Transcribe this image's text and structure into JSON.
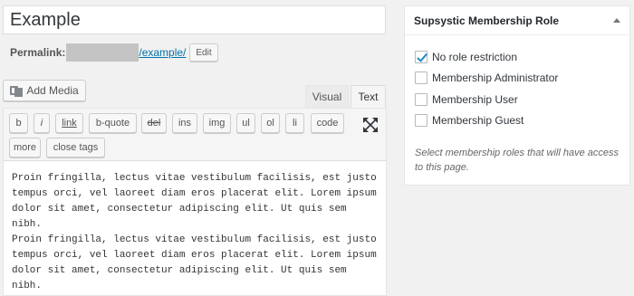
{
  "post": {
    "title": "Example",
    "permalink_label": "Permalink:",
    "permalink_slug": "/example/",
    "edit_label": "Edit"
  },
  "editor": {
    "add_media_label": "Add Media",
    "tabs": {
      "visual": "Visual",
      "text": "Text"
    },
    "quicktags": [
      "b",
      "i",
      "link",
      "b-quote",
      "del",
      "ins",
      "img",
      "ul",
      "ol",
      "li",
      "code",
      "more",
      "close tags"
    ],
    "fullscreen_icon": "fullscreen-icon",
    "content": "Proin fringilla, lectus vitae vestibulum facilisis, est justo\ntempus orci, vel laoreet diam eros placerat elit. Lorem ipsum\ndolor sit amet, consectetur adipiscing elit. Ut quis sem nibh.\nProin fringilla, lectus vitae vestibulum facilisis, est justo\ntempus orci, vel laoreet diam eros placerat elit. Lorem ipsum\ndolor sit amet, consectetur adipiscing elit. Ut quis sem nibh.\nProin fringilla, lectus vitae vestibulum facilisis."
  },
  "membership_box": {
    "title": "Supsystic Membership Role",
    "roles": [
      {
        "label": "No role restriction",
        "checked": true
      },
      {
        "label": "Membership Administrator",
        "checked": false
      },
      {
        "label": "Membership User",
        "checked": false
      },
      {
        "label": "Membership Guest",
        "checked": false
      }
    ],
    "description": "Select membership roles that will have access to this page."
  },
  "colors": {
    "link": "#0073aa",
    "checkmark": "#1e8cbe",
    "background": "#f1f1f1"
  }
}
